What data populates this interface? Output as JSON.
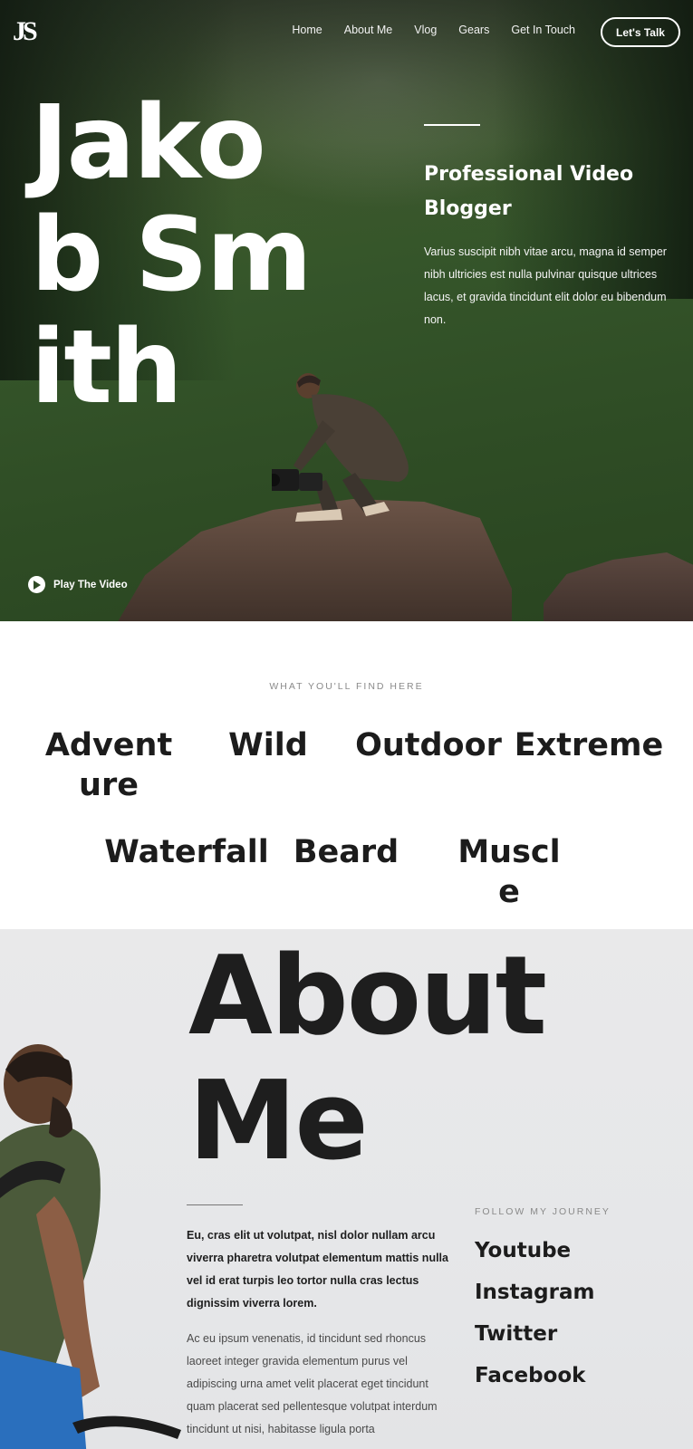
{
  "header": {
    "logo_text": "JS",
    "nav": [
      "Home",
      "About Me",
      "Vlog",
      "Gears",
      "Get In Touch"
    ],
    "cta_label": "Let's Talk"
  },
  "hero": {
    "name": "Jakob Smith",
    "title": "Professional Video Blogger",
    "description": "Varius suscipit nibh vitae arcu, magna id semper nibh ultricies est nulla pulvinar quisque ultrices lacus, et gravida tincidunt elit dolor eu bibendum non.",
    "play_label": "Play The Video"
  },
  "topics": {
    "label": "WHAT YOU'LL FIND HERE",
    "items": [
      "Adventure",
      "Wild",
      "Outdoor",
      "Extreme",
      "Waterfall",
      "Beard",
      "Muscle"
    ]
  },
  "about": {
    "title": "About Me",
    "lead": "Eu, cras elit ut volutpat, nisl dolor nullam arcu viverra pharetra volutpat elementum mattis nulla vel id erat turpis leo tortor nulla cras lectus dignissim viverra lorem.",
    "body": "Ac eu ipsum venenatis, id tincidunt sed rhoncus laoreet integer gravida elementum purus vel adipiscing urna amet velit placerat eget tincidunt quam placerat sed pellentesque volutpat interdum tincidunt ut nisi, habitasse ligula porta",
    "follow_label": "FOLLOW MY JOURNEY",
    "social": [
      "Youtube",
      "Instagram",
      "Twitter",
      "Facebook"
    ]
  },
  "colors": {
    "text_dark": "#1c1c1c",
    "muted": "#8a8a8a",
    "hero_green": "#35552a",
    "about_bg": "#e9e9ea"
  }
}
